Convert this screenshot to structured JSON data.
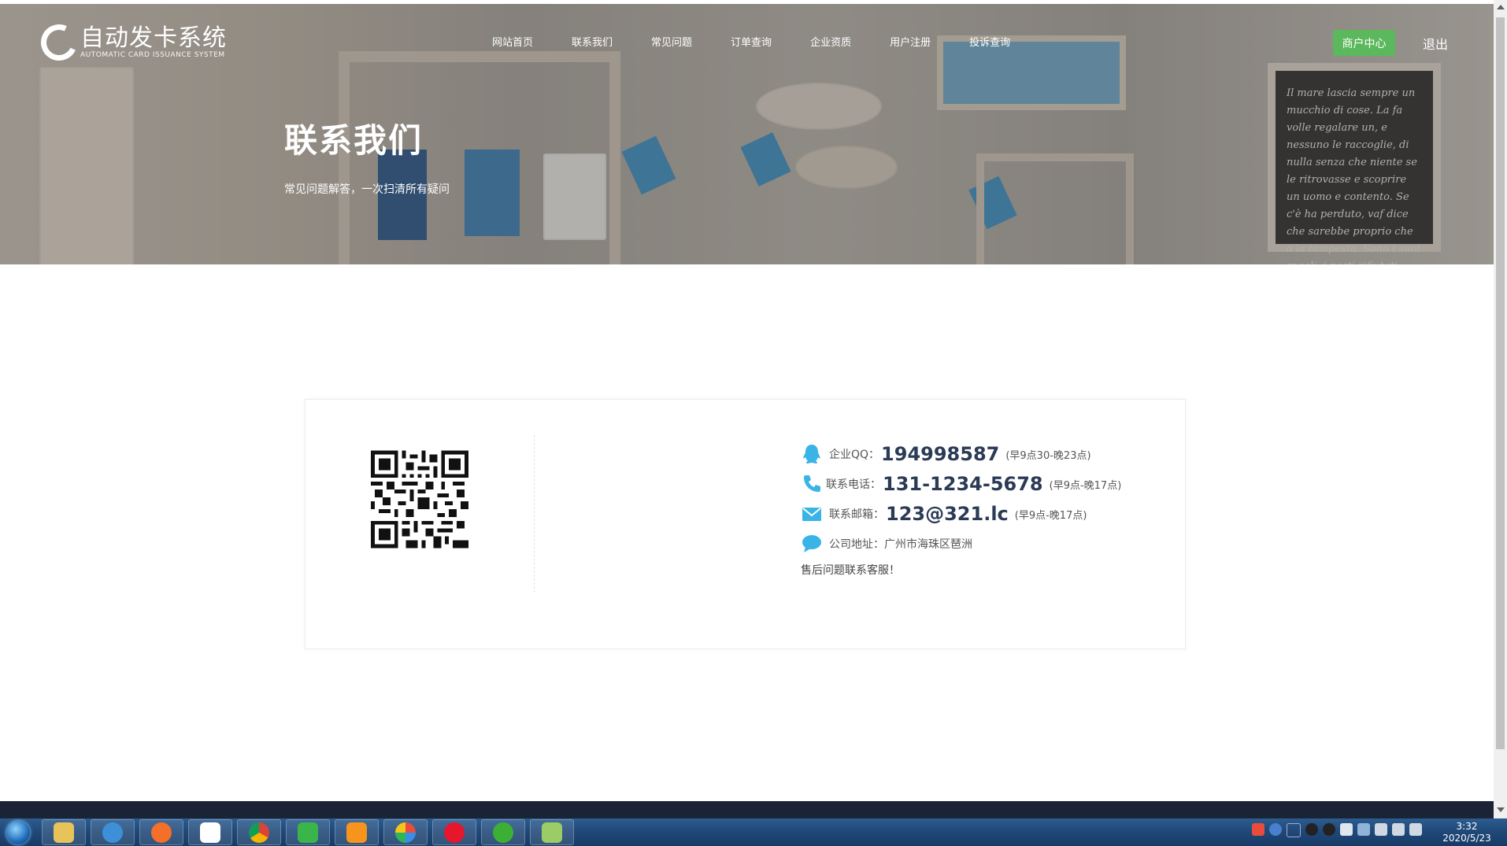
{
  "header": {
    "logo_cn": "自动发卡系统",
    "logo_en": "AUTOMATIC CARD ISSUANCE SYSTEM",
    "nav": [
      "网站首页",
      "联系我们",
      "常见问题",
      "订单查询",
      "企业资质",
      "用户注册",
      "投诉查询"
    ],
    "merchant_button": "商户中心",
    "logout": "退出"
  },
  "hero": {
    "title": "联系我们",
    "subtitle": "常见问题解答，一次扫清所有疑问",
    "chalkboard_text": "Il mare lascia sempre un mucchio di cose. La fa volle regalare un, e nessuno le raccoglie, di nulla senza che niente se le ritrovasse e scoprire un uomo e contento. Se c'è ha perduto, vaf dice che sarebbe proprio che a la tempesta. Sono i suoi regali, i posti rifiutati. Tratto dal romanzo \"Il fondale delle luna\" di Paola Mastrocola"
  },
  "contact": {
    "qq_label": "企业QQ：",
    "qq_value": "194998587",
    "qq_hours": "(早9点30-晚23点)",
    "phone_label": "联系电话：",
    "phone_value": "131-1234-5678",
    "phone_hours": "(早9点-晚17点)",
    "email_label": "联系邮箱：",
    "email_value": "123@321.lc",
    "email_hours": "(早9点-晚17点)",
    "address_label": "公司地址：",
    "address_value": "广州市海珠区琶洲",
    "note": "售后问题联系客服！"
  },
  "taskbar": {
    "apps": [
      "file-explorer",
      "internet-explorer",
      "firefox",
      "baidu-netdisk",
      "chrome",
      "media-player",
      "uc-browser",
      "360-browser",
      "weibo",
      "wechat",
      "notepad-plus"
    ],
    "time": "3:32",
    "date": "2020/5/23"
  },
  "colors": {
    "accent_green": "#5cb85c",
    "icon_blue": "#3ab4e6",
    "number_navy": "#2b3a55"
  }
}
